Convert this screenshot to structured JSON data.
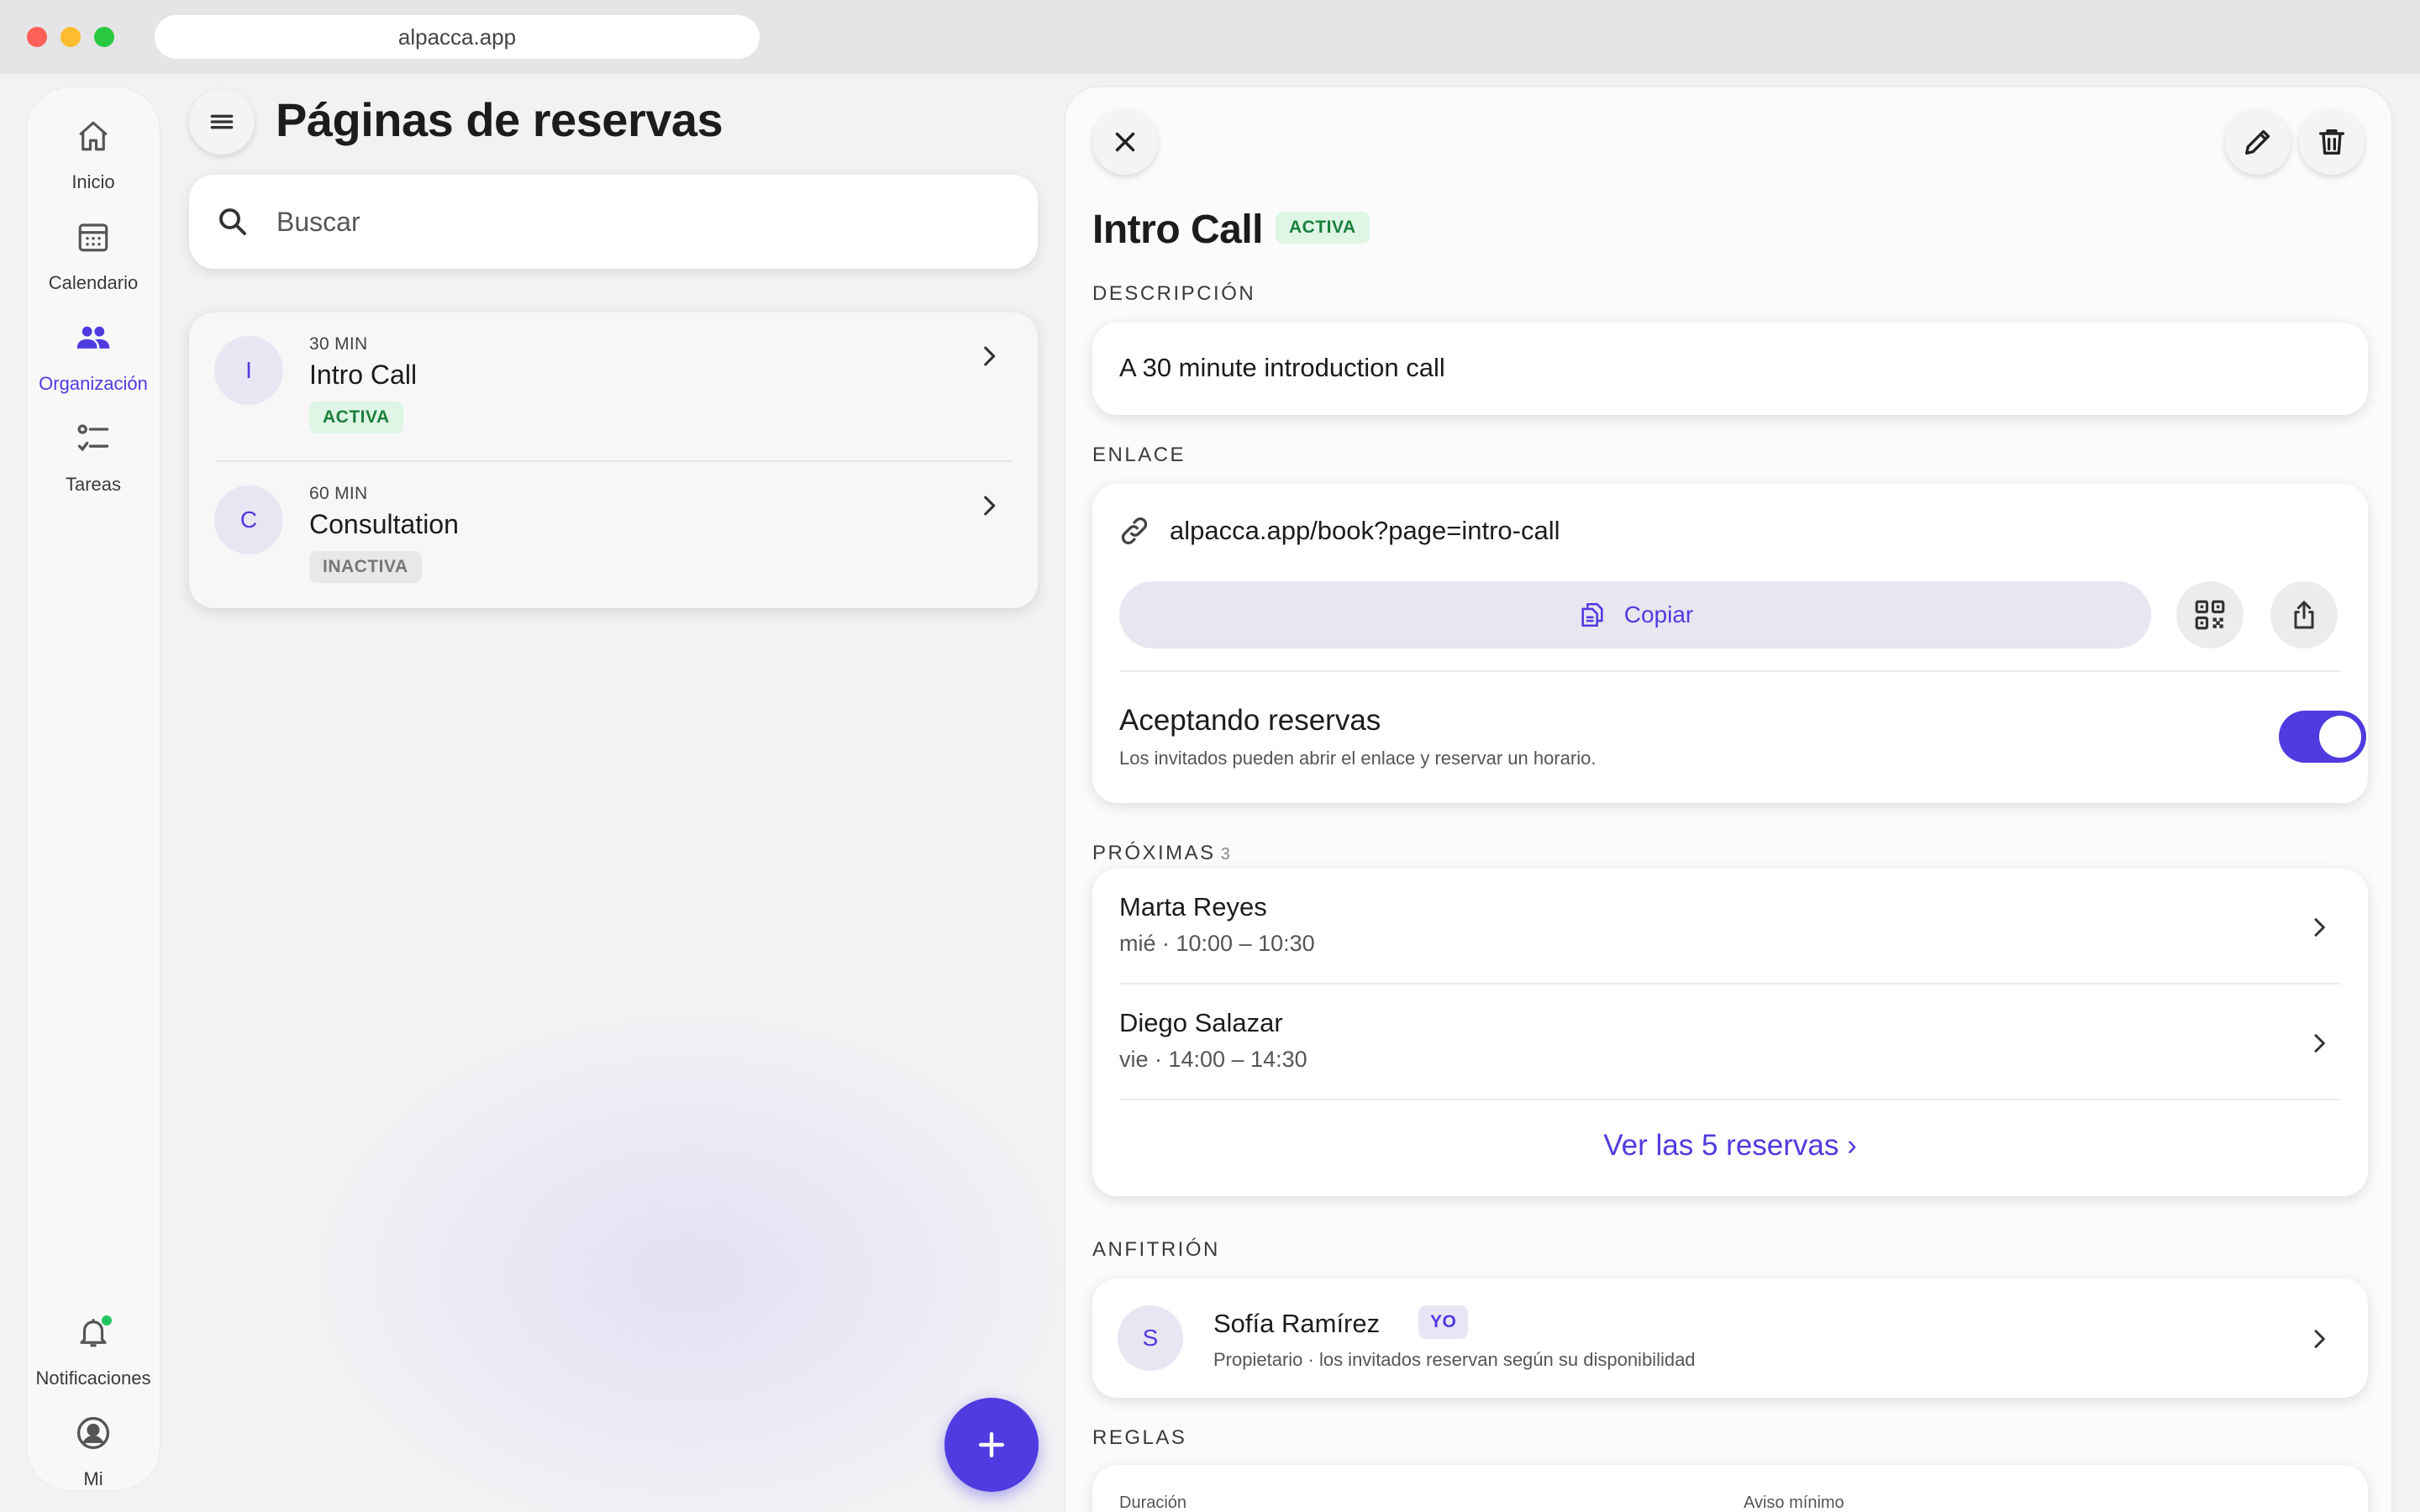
{
  "browser": {
    "url": "alpacca.app"
  },
  "rail": {
    "items": [
      {
        "label": "Inicio",
        "icon": "home-icon"
      },
      {
        "label": "Calendario",
        "icon": "calendar-icon"
      },
      {
        "label": "Organización",
        "icon": "people-icon",
        "active": true
      },
      {
        "label": "Tareas",
        "icon": "tasks-icon"
      }
    ],
    "bottom": [
      {
        "label": "Notificaciones",
        "icon": "bell-icon"
      },
      {
        "label": "Mi",
        "icon": "profile-icon"
      }
    ]
  },
  "list": {
    "title": "Páginas de reservas",
    "search_placeholder": "Buscar",
    "items": [
      {
        "initial": "I",
        "duration": "30 MIN",
        "name": "Intro Call",
        "status": "ACTIVA"
      },
      {
        "initial": "C",
        "duration": "60 MIN",
        "name": "Consultation",
        "status": "INACTIVA"
      }
    ]
  },
  "detail": {
    "title": "Intro Call",
    "status": "ACTIVA",
    "description_label": "DESCRIPCIÓN",
    "description": "A 30 minute introduction call",
    "link_label": "ENLACE",
    "link": "alpacca.app/book?page=intro-call",
    "copy_label": "Copiar",
    "accepting_title": "Aceptando reservas",
    "accepting_sub": "Los invitados pueden abrir el enlace y reservar un horario.",
    "accepting_on": true,
    "upcoming_label": "PRÓXIMAS",
    "upcoming_count": "3",
    "bookings": [
      {
        "name": "Marta Reyes",
        "time": "mié · 10:00 – 10:30"
      },
      {
        "name": "Diego Salazar",
        "time": "vie · 14:00 – 14:30"
      }
    ],
    "see_all": "Ver las 5 reservas ›",
    "host_label": "ANFITRIÓN",
    "host": {
      "initial": "S",
      "name": "Sofía Ramírez",
      "badge": "YO",
      "sub": "Propietario · los invitados reservan según su disponibilidad"
    },
    "rules_label": "REGLAS",
    "rules": {
      "duration_label": "Duración",
      "notice_label": "Aviso mínimo"
    }
  },
  "colors": {
    "accent": "#4f3be0",
    "active_green": "#1a7f3c",
    "notif_dot": "#22c55e"
  }
}
